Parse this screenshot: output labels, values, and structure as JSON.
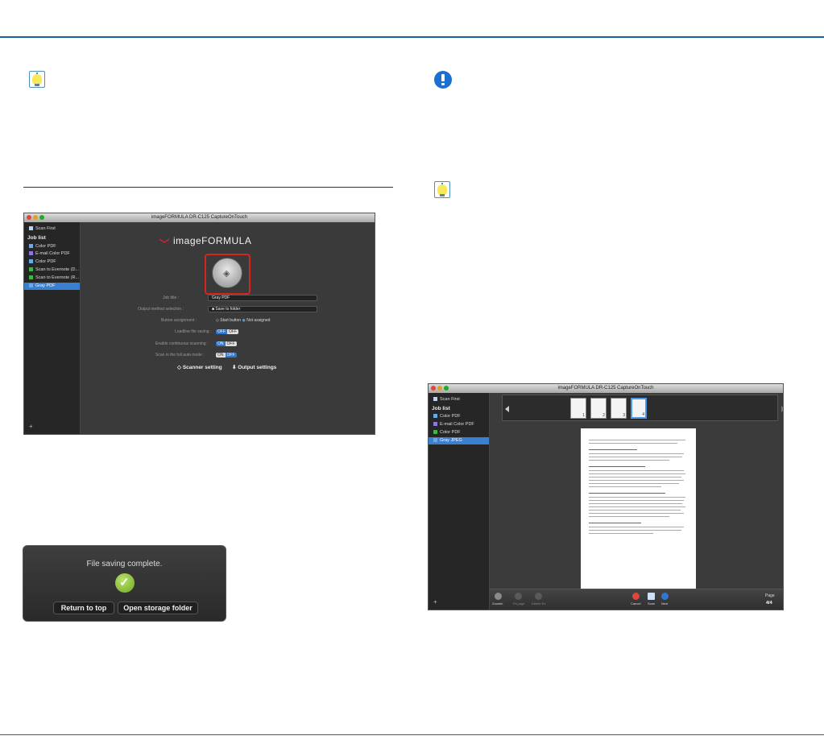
{
  "window1": {
    "title": "imageFORMULA DR-C125 CaptureOnTouch",
    "sidebar": {
      "scan_first": "Scan First",
      "job_list_header": "Job list",
      "items": [
        "Color PDF",
        "E-mail Color PDF",
        "Color PDF",
        "Scan to Evernote (D...",
        "Scan to Evernote (R...",
        "Gray PDF"
      ]
    },
    "logo": "imageFORMULA",
    "rows": {
      "job_title_label": "Job title :",
      "job_title_value": "Gray PDF",
      "output_label": "Output method selection :",
      "output_value": "Save to folder",
      "button_label": "Button assignment :",
      "start_button": "Start button",
      "not_assigned": "Not assigned",
      "loadline_label": "Loadline file saving :",
      "continuous_label": "Enable continuous scanning :",
      "auto_label": "Scan in the full auto mode :",
      "on": "ON",
      "off": "OFF"
    },
    "scanner_setting": "Scanner setting",
    "output_settings": "Output settings"
  },
  "dialog": {
    "message": "File saving complete.",
    "return_button": "Return to top",
    "open_button": "Open storage folder"
  },
  "window2": {
    "title": "imageFORMULA DR-C125 CaptureOnTouch",
    "sidebar": {
      "scan_first": "Scan First",
      "job_list_header": "Job list",
      "items": [
        "Color PDF",
        "E-mail Color PDF",
        "Color PDF",
        "Gray JPEG"
      ]
    },
    "thumbnails": [
      "1",
      "2",
      "3",
      "4"
    ],
    "toolbar": {
      "zoom": "Zoomin",
      "rotate": "Fit page",
      "delete": "Delete Ex",
      "cancel": "Cancel",
      "scan": "Scan",
      "next": "Next",
      "page_label": "Page",
      "page_value": "4/4"
    }
  },
  "colors": {
    "header_rule": "#1a5fa8",
    "start_highlight": "#d8231f",
    "selection": "#3b7fd1"
  }
}
